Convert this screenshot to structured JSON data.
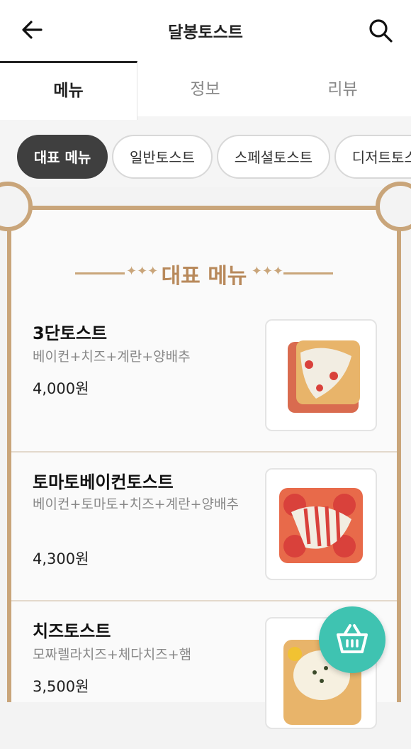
{
  "header": {
    "title": "달봉토스트",
    "back_icon": "arrow-left-icon",
    "search_icon": "search-icon"
  },
  "tabs": [
    {
      "label": "메뉴",
      "active": true
    },
    {
      "label": "정보",
      "active": false
    },
    {
      "label": "리뷰",
      "active": false
    }
  ],
  "chips": [
    {
      "label": "대표 메뉴",
      "active": true
    },
    {
      "label": "일반토스트",
      "active": false
    },
    {
      "label": "스페셜토스트",
      "active": false
    },
    {
      "label": "디저트토스트",
      "active": false
    }
  ],
  "section": {
    "title": "대표 메뉴",
    "accent_color": "#c9a57a"
  },
  "menu_items": [
    {
      "name": "3단토스트",
      "desc": "베이컨+치즈+계란+양배추",
      "price": "4,000원"
    },
    {
      "name": "토마토베이컨토스트",
      "desc": "베이컨+토마토+치즈+계란+양배추",
      "price": "4,300원"
    },
    {
      "name": "치즈토스트",
      "desc": "모짜렐라치즈+체다치즈+햄",
      "price": "3,500원"
    }
  ],
  "fab": {
    "icon": "basket-icon",
    "color": "#3fc3b1"
  }
}
